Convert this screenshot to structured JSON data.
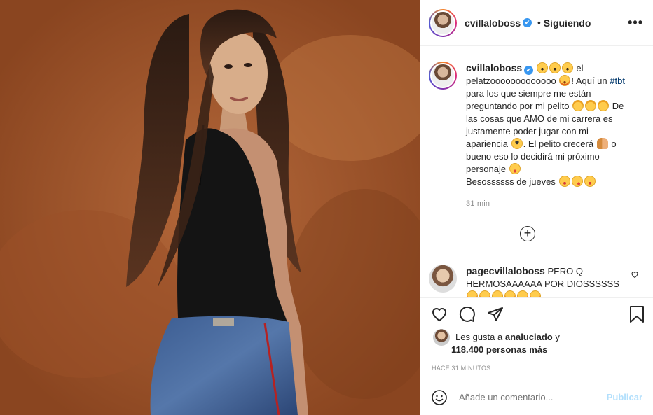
{
  "post": {
    "username": "cvillaloboss",
    "verified_glyph": "✔",
    "separator": "•",
    "follow_label": "Siguiendo",
    "more_label": "•••",
    "caption": {
      "p1": "el pelatzooooooooooooo",
      "p2": "! Aquí un",
      "hashtag": "#tbt",
      "p3": "para los que siempre me están preguntando por mi pelito",
      "p4": "De las cosas que AMO de mi carrera es justamente poder jugar con mi apariencia",
      "p5": ". El pelito crecerá",
      "p6": "o bueno eso lo decidirá mi próximo personaje",
      "p7": "Besossssss de jueves"
    },
    "time_ago": "31 min",
    "load_more": "+",
    "comment": {
      "username": "pagecvillaloboss",
      "text": "PERO Q HERMOSAAAAAA POR DIOSSSSSS"
    },
    "likes": {
      "prefix": "Les gusta a",
      "user": "analuciado",
      "conj": "y",
      "count_text": "118.400 personas más"
    },
    "posted_ago": "HACE 31 MINUTOS",
    "add_comment_placeholder": "Añade un comentario...",
    "post_button": "Publicar"
  },
  "colors": {
    "verified": "#3897f0",
    "hashtag": "#00376b",
    "post_disabled": "#b2dffc",
    "photo_bg": "#a4572c"
  },
  "icons": [
    "emoji-icon",
    "heart-icon",
    "comment-icon",
    "share-icon",
    "bookmark-icon",
    "more-icon",
    "plus-circle-icon"
  ]
}
